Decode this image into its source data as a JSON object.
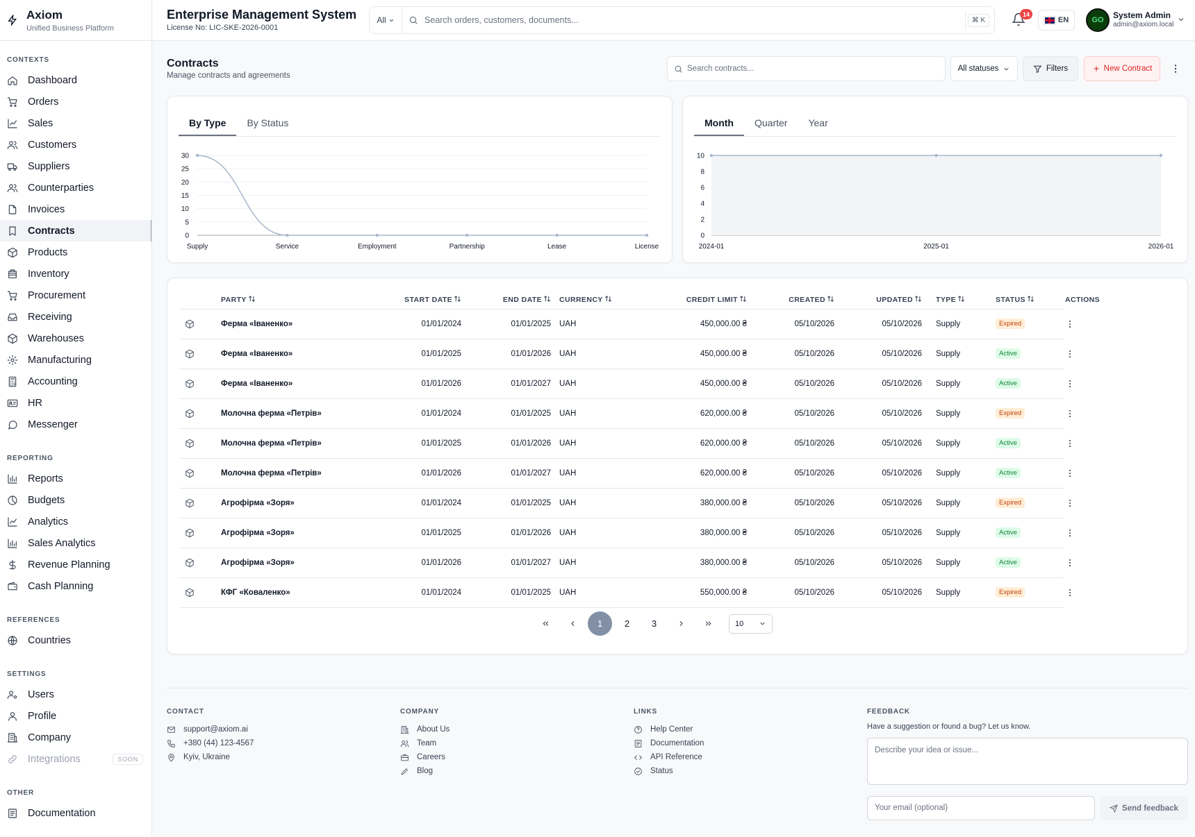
{
  "brand": {
    "title": "Axiom",
    "subtitle": "Unified Business Platform"
  },
  "sidebar": {
    "sections": [
      {
        "heading": "CONTEXTS",
        "items": [
          {
            "label": "Dashboard",
            "icon": "home-icon"
          },
          {
            "label": "Orders",
            "icon": "cart-icon"
          },
          {
            "label": "Sales",
            "icon": "trend-icon"
          },
          {
            "label": "Customers",
            "icon": "users-icon"
          },
          {
            "label": "Suppliers",
            "icon": "truck-icon"
          },
          {
            "label": "Counterparties",
            "icon": "users-icon"
          },
          {
            "label": "Invoices",
            "icon": "file-icon"
          },
          {
            "label": "Contracts",
            "icon": "bookmark-icon",
            "active": true
          },
          {
            "label": "Products",
            "icon": "box-icon"
          },
          {
            "label": "Inventory",
            "icon": "database-icon"
          },
          {
            "label": "Procurement",
            "icon": "cart-icon"
          },
          {
            "label": "Receiving",
            "icon": "inbox-icon"
          },
          {
            "label": "Warehouses",
            "icon": "box-icon"
          },
          {
            "label": "Manufacturing",
            "icon": "gear-icon"
          },
          {
            "label": "Accounting",
            "icon": "calculator-icon"
          },
          {
            "label": "HR",
            "icon": "id-card-icon"
          },
          {
            "label": "Messenger",
            "icon": "chat-icon"
          }
        ]
      },
      {
        "heading": "REPORTING",
        "items": [
          {
            "label": "Reports",
            "icon": "bar-chart-icon"
          },
          {
            "label": "Budgets",
            "icon": "pie-icon"
          },
          {
            "label": "Analytics",
            "icon": "trend-icon"
          },
          {
            "label": "Sales Analytics",
            "icon": "bar-chart-icon"
          },
          {
            "label": "Revenue Planning",
            "icon": "dollar-icon"
          },
          {
            "label": "Cash Planning",
            "icon": "wallet-icon"
          }
        ]
      },
      {
        "heading": "REFERENCES",
        "items": [
          {
            "label": "Countries",
            "icon": "globe-icon"
          }
        ]
      },
      {
        "heading": "SETTINGS",
        "items": [
          {
            "label": "Users",
            "icon": "users-gear-icon"
          },
          {
            "label": "Profile",
            "icon": "user-icon"
          },
          {
            "label": "Company",
            "icon": "building-icon"
          },
          {
            "label": "Integrations",
            "icon": "link-icon",
            "disabled": true,
            "badge": "SOON"
          }
        ]
      },
      {
        "heading": "OTHER",
        "items": [
          {
            "label": "Documentation",
            "icon": "doc-icon"
          }
        ]
      }
    ]
  },
  "header": {
    "title": "Enterprise Management System",
    "license": "License No: LIC-SKE-2026-0001",
    "search_scope": "All",
    "search_placeholder": "Search orders, customers, documents...",
    "shortcut": "⌘ K",
    "notifications": "14",
    "language": "EN",
    "avatar_text": "GO",
    "user_name": "System Admin",
    "user_email": "admin@axiom.local"
  },
  "page": {
    "title": "Contracts",
    "subtitle": "Manage contracts and agreements",
    "search_placeholder": "Search contracts...",
    "status_filter": "All statuses",
    "filters_label": "Filters",
    "new_label": "New Contract"
  },
  "chart_tabs_left": [
    {
      "label": "By Type",
      "active": true
    },
    {
      "label": "By Status",
      "active": false
    }
  ],
  "chart_tabs_right": [
    {
      "label": "Month",
      "active": true
    },
    {
      "label": "Quarter",
      "active": false
    },
    {
      "label": "Year",
      "active": false
    }
  ],
  "chart_data": [
    {
      "type": "line",
      "categories": [
        "Supply",
        "Service",
        "Employment",
        "Partnership",
        "Lease",
        "License"
      ],
      "values": [
        30,
        0,
        0,
        0,
        0,
        0
      ],
      "yticks": [
        0,
        5,
        10,
        15,
        20,
        25,
        30
      ],
      "ylim": [
        0,
        30
      ],
      "grid": true,
      "color": "#a9b7cc"
    },
    {
      "type": "area",
      "categories": [
        "2024-01",
        "2025-01",
        "2026-01"
      ],
      "values": [
        10,
        10,
        10
      ],
      "yticks": [
        0,
        2,
        4,
        6,
        8,
        10
      ],
      "ylim": [
        0,
        10
      ],
      "grid": true,
      "color": "#a9b7cc"
    }
  ],
  "table": {
    "columns": [
      "PARTY",
      "START DATE",
      "END DATE",
      "CURRENCY",
      "CREDIT LIMIT",
      "CREATED",
      "UPDATED",
      "TYPE",
      "STATUS",
      "ACTIONS"
    ],
    "rows": [
      {
        "party": "Ферма «Іваненко»",
        "start": "01/01/2024",
        "end": "01/01/2025",
        "currency": "UAH",
        "credit": "450,000.00 ₴",
        "created": "05/10/2026",
        "updated": "05/10/2026",
        "type": "Supply",
        "status": "Expired"
      },
      {
        "party": "Ферма «Іваненко»",
        "start": "01/01/2025",
        "end": "01/01/2026",
        "currency": "UAH",
        "credit": "450,000.00 ₴",
        "created": "05/10/2026",
        "updated": "05/10/2026",
        "type": "Supply",
        "status": "Active"
      },
      {
        "party": "Ферма «Іваненко»",
        "start": "01/01/2026",
        "end": "01/01/2027",
        "currency": "UAH",
        "credit": "450,000.00 ₴",
        "created": "05/10/2026",
        "updated": "05/10/2026",
        "type": "Supply",
        "status": "Active"
      },
      {
        "party": "Молочна ферма «Петрів»",
        "start": "01/01/2024",
        "end": "01/01/2025",
        "currency": "UAH",
        "credit": "620,000.00 ₴",
        "created": "05/10/2026",
        "updated": "05/10/2026",
        "type": "Supply",
        "status": "Expired"
      },
      {
        "party": "Молочна ферма «Петрів»",
        "start": "01/01/2025",
        "end": "01/01/2026",
        "currency": "UAH",
        "credit": "620,000.00 ₴",
        "created": "05/10/2026",
        "updated": "05/10/2026",
        "type": "Supply",
        "status": "Active"
      },
      {
        "party": "Молочна ферма «Петрів»",
        "start": "01/01/2026",
        "end": "01/01/2027",
        "currency": "UAH",
        "credit": "620,000.00 ₴",
        "created": "05/10/2026",
        "updated": "05/10/2026",
        "type": "Supply",
        "status": "Active"
      },
      {
        "party": "Агрофірма «Зоря»",
        "start": "01/01/2024",
        "end": "01/01/2025",
        "currency": "UAH",
        "credit": "380,000.00 ₴",
        "created": "05/10/2026",
        "updated": "05/10/2026",
        "type": "Supply",
        "status": "Expired"
      },
      {
        "party": "Агрофірма «Зоря»",
        "start": "01/01/2025",
        "end": "01/01/2026",
        "currency": "UAH",
        "credit": "380,000.00 ₴",
        "created": "05/10/2026",
        "updated": "05/10/2026",
        "type": "Supply",
        "status": "Active"
      },
      {
        "party": "Агрофірма «Зоря»",
        "start": "01/01/2026",
        "end": "01/01/2027",
        "currency": "UAH",
        "credit": "380,000.00 ₴",
        "created": "05/10/2026",
        "updated": "05/10/2026",
        "type": "Supply",
        "status": "Active"
      },
      {
        "party": "КФГ «Коваленко»",
        "start": "01/01/2024",
        "end": "01/01/2025",
        "currency": "UAH",
        "credit": "550,000.00 ₴",
        "created": "05/10/2026",
        "updated": "05/10/2026",
        "type": "Supply",
        "status": "Expired"
      }
    ]
  },
  "pagination": {
    "pages": [
      "1",
      "2",
      "3"
    ],
    "current": "1",
    "page_size": "10"
  },
  "footer": {
    "contact": {
      "heading": "CONTACT",
      "items": [
        {
          "label": "support@axiom.ai",
          "icon": "mail-icon"
        },
        {
          "label": "+380 (44) 123-4567",
          "icon": "phone-icon"
        },
        {
          "label": "Kyiv, Ukraine",
          "icon": "pin-icon"
        }
      ]
    },
    "company": {
      "heading": "COMPANY",
      "items": [
        {
          "label": "About Us",
          "icon": "building-icon"
        },
        {
          "label": "Team",
          "icon": "users-icon"
        },
        {
          "label": "Careers",
          "icon": "briefcase-icon"
        },
        {
          "label": "Blog",
          "icon": "pen-icon"
        }
      ]
    },
    "links": {
      "heading": "LINKS",
      "items": [
        {
          "label": "Help Center",
          "icon": "help-icon"
        },
        {
          "label": "Documentation",
          "icon": "doc-icon"
        },
        {
          "label": "API Reference",
          "icon": "code-icon"
        },
        {
          "label": "Status",
          "icon": "check-circle-icon"
        }
      ]
    },
    "feedback": {
      "heading": "FEEDBACK",
      "description": "Have a suggestion or found a bug? Let us know.",
      "placeholder": "Describe your idea or issue...",
      "email_placeholder": "Your email (optional)",
      "send_label": "Send feedback"
    }
  }
}
